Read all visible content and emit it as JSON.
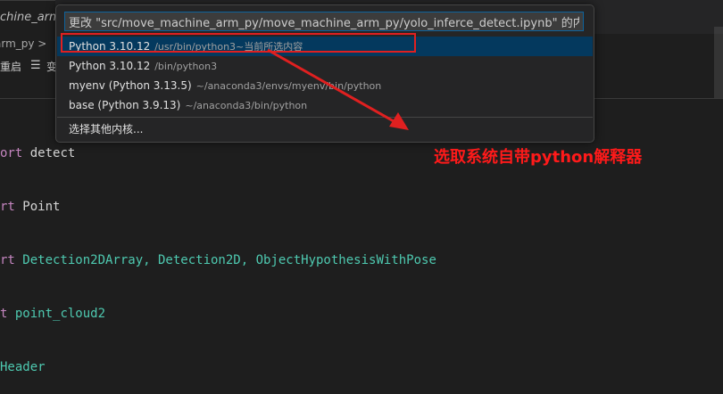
{
  "editor": {
    "tab_label": "achine_arm",
    "breadcrumb": "arm_py >",
    "toolbar_restart": "重启",
    "toolbar_variables_icon": "list-icon",
    "toolbar_variables_label": "变"
  },
  "code_lines": [
    {
      "kw": "ort",
      "rest": " detect"
    },
    {
      "kw": "rt",
      "rest": " Point"
    },
    {
      "kw": "rt",
      "rest": " Detection2DArray, Detection2D, ObjectHypothesisWithPose"
    },
    {
      "kw": "t",
      "rest": " point_cloud2"
    },
    {
      "kw": "",
      "rest": "Header"
    }
  ],
  "kernel_picker": {
    "input_value": "更改 \"src/move_machine_arm_py/move_machine_arm_py/yolo_inferce_detect.ipynb\" 的内核",
    "items": [
      {
        "label": "Python 3.10.12",
        "description": "/usr/bin/python3~当前所选内容"
      },
      {
        "label": "Python 3.10.12",
        "description": "/bin/python3"
      },
      {
        "label": "myenv (Python 3.13.5)",
        "description": "~/anaconda3/envs/myenv/bin/python"
      },
      {
        "label": "base (Python 3.9.13)",
        "description": "~/anaconda3/bin/python"
      }
    ],
    "other_kernel_label": "选择其他内核..."
  },
  "annotation": {
    "text": "选取系统自带python解释器",
    "color": "#ff1a1a"
  }
}
